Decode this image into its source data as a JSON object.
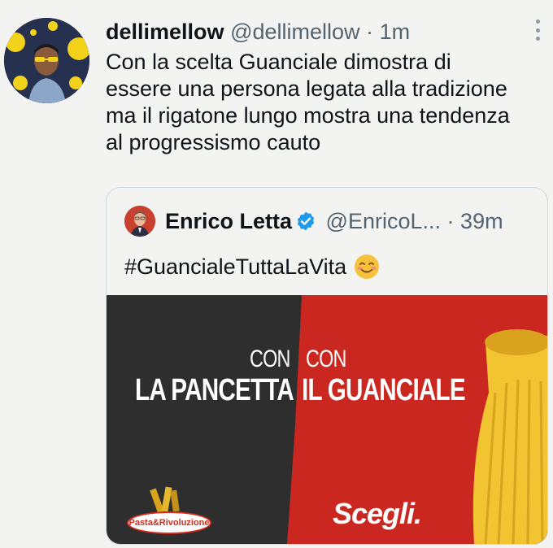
{
  "tweet": {
    "display_name": "dellimellow",
    "handle": "@dellimellow",
    "separator": "·",
    "time": "1m",
    "text_lines": [
      "Con la scelta Guanciale dimostra di",
      "essere una persona legata alla tradizione",
      "ma il rigatone lungo mostra una tendenza",
      "al progressismo cauto"
    ]
  },
  "quote": {
    "display_name": "Enrico Letta",
    "handle": "@EnricoL...",
    "separator": "·",
    "time": "39m",
    "text": "#GuancialeTuttaLaVita",
    "image": {
      "left_small": "CON",
      "right_small": "CON",
      "left_big": "LA PANCETTA",
      "right_big": "IL GUANCIALE",
      "cta": "Scegli.",
      "logo": "Pasta&Rivoluzione"
    }
  },
  "icons": {
    "more": "more-vertical-icon",
    "verified": "verified-badge-icon",
    "emoji": "smiling-face-emoji"
  },
  "colors": {
    "background": "#f3f3f1",
    "secondary_text": "#536471",
    "verified_blue": "#1d9bf0",
    "ad_dark": "#2f2e2e",
    "ad_red": "#c9271f",
    "pasta_yellow": "#f2c431"
  }
}
